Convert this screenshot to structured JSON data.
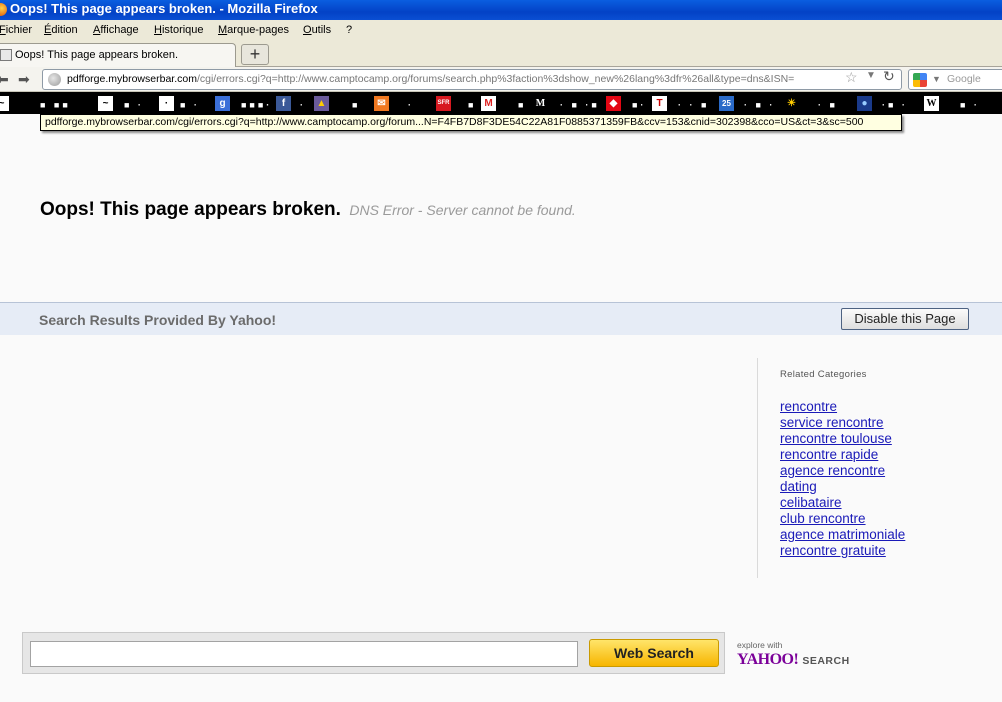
{
  "window": {
    "title": "Oops! This page appears broken. - Mozilla Firefox"
  },
  "menu": {
    "items": [
      "Fichier",
      "Édition",
      "Affichage",
      "Historique",
      "Marque-pages",
      "Outils",
      "?"
    ]
  },
  "tabs": [
    {
      "label": "Oops! This page appears broken."
    }
  ],
  "newtab_label": "+",
  "nav": {
    "back": "⬅",
    "forward": "➡",
    "reload": "↻",
    "star": "☆",
    "dropdown": "▼",
    "url_host": "pdfforge.mybrowserbar.com",
    "url_rest": "/cgi/errors.cgi?q=http://www.camptocamp.org/forums/search.php%3faction%3dshow_new%26lang%3dfr%26all&type=dns&ISN=",
    "search_placeholder": "Google",
    "search_dropdown": "▼"
  },
  "bookmarks": {
    "icons": [
      {
        "name": "bookmark-chart-icon",
        "glyph": "~"
      },
      {
        "name": "bookmark-page-icon",
        "glyph": "·"
      },
      {
        "name": "google-icon",
        "glyph": "g"
      },
      {
        "name": "facebook-icon",
        "glyph": "f"
      },
      {
        "name": "bookmark-photo-icon",
        "glyph": "▲"
      },
      {
        "name": "bookmark-mail-icon",
        "glyph": "✉"
      },
      {
        "name": "sfr-icon",
        "glyph": "SFR"
      },
      {
        "name": "gmail-icon",
        "glyph": "M"
      },
      {
        "name": "lemonde-icon",
        "glyph": "M"
      },
      {
        "name": "bookmark-red-icon",
        "glyph": "◆"
      },
      {
        "name": "bookmark-t-icon",
        "glyph": "T"
      },
      {
        "name": "calendar-icon",
        "glyph": "25"
      },
      {
        "name": "weather-icon",
        "glyph": "☀"
      },
      {
        "name": "bookmark-globe-icon",
        "glyph": "●"
      },
      {
        "name": "wikipedia-icon",
        "glyph": "W"
      }
    ]
  },
  "tooltip": "pdfforge.mybrowserbar.com/cgi/errors.cgi?q=http://www.camptocamp.org/forum...N=F4FB7D8F3DE54C22A81F0885371359FB&ccv=153&cnid=302398&cco=US&ct=3&sc=500",
  "page": {
    "heading": "Oops! This page appears broken.",
    "subheading": "DNS Error - Server cannot be found.",
    "provider_text": "Search Results Provided By Yahoo!",
    "disable_button": "Disable this Page",
    "related_title": "Related Categories",
    "related": [
      "rencontre",
      "service rencontre",
      "rencontre toulouse",
      "rencontre rapide",
      "agence rencontre",
      "dating",
      "celibataire",
      "club rencontre",
      "agence matrimoniale",
      "rencontre gratuite"
    ],
    "search_value": "",
    "search_button": "Web Search",
    "yahoo_explore": "explore with",
    "yahoo_logo": "YAHOO!",
    "yahoo_search": "SEARCH"
  }
}
